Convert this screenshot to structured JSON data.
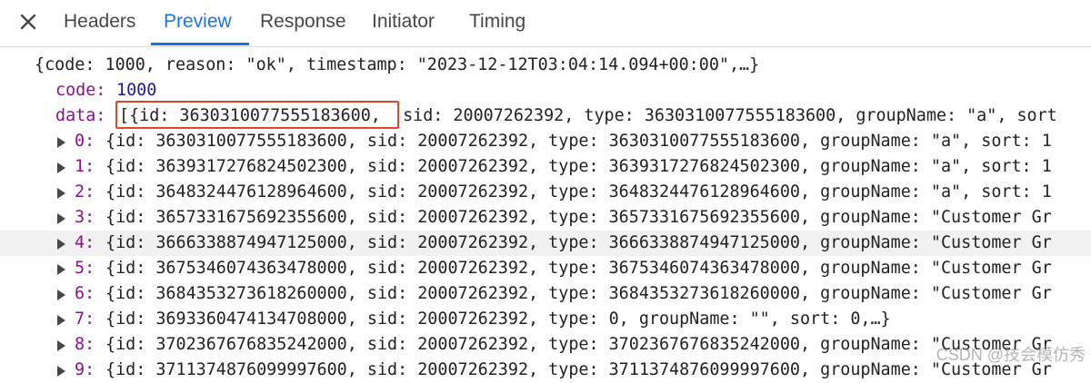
{
  "tabs": {
    "items": [
      {
        "label": "Headers"
      },
      {
        "label": "Preview"
      },
      {
        "label": "Response"
      },
      {
        "label": "Initiator"
      },
      {
        "label": "Timing"
      }
    ],
    "active": "Preview"
  },
  "tree": {
    "root": "{code: 1000, reason: \"ok\", timestamp: \"2023-12-12T03:04:14.094+00:00\",…}",
    "code_key": "code:",
    "code_value": "1000",
    "data_key": "data:",
    "data_summary_start": "[{id: 3630310077555183600,",
    "data_summary_rest": " sid: 20007262392, type: 3630310077555183600, groupName: \"a\", sort",
    "items": [
      {
        "index": "0:",
        "text": "{id: 3630310077555183600, sid: 20007262392, type: 3630310077555183600, groupName: \"a\", sort: 1"
      },
      {
        "index": "1:",
        "text": "{id: 3639317276824502300, sid: 20007262392, type: 3639317276824502300, groupName: \"a\", sort: 1"
      },
      {
        "index": "2:",
        "text": "{id: 3648324476128964600, sid: 20007262392, type: 3648324476128964600, groupName: \"a\", sort: 1"
      },
      {
        "index": "3:",
        "text": "{id: 3657331675692355600, sid: 20007262392, type: 3657331675692355600, groupName: \"Customer Gr"
      },
      {
        "index": "4:",
        "text": "{id: 3666338874947125000, sid: 20007262392, type: 3666338874947125000, groupName: \"Customer Gr"
      },
      {
        "index": "5:",
        "text": "{id: 3675346074363478000, sid: 20007262392, type: 3675346074363478000, groupName: \"Customer Gr"
      },
      {
        "index": "6:",
        "text": "{id: 3684353273618260000, sid: 20007262392, type: 3684353273618260000, groupName: \"Customer Gr"
      },
      {
        "index": "7:",
        "text": "{id: 3693360474134708000, sid: 20007262392, type: 0, groupName: \"\", sort: 0,…}"
      },
      {
        "index": "8:",
        "text": "{id: 3702367676835242000, sid: 20007262392, type: 3702367676835242000, groupName: \"Customer Gr"
      },
      {
        "index": "9:",
        "text": "{id: 3711374876099997600, sid: 20007262392, type: 3711374876099997600, groupName: \"Customer Gr"
      }
    ]
  },
  "highlighted_row": "4:",
  "watermark": "CSDN @技会模仿秀",
  "colors": {
    "accent": "#1a73e8",
    "key": "#881391",
    "number": "#1a1aa6",
    "string": "#c41a16",
    "annotation": "#e0462b"
  }
}
